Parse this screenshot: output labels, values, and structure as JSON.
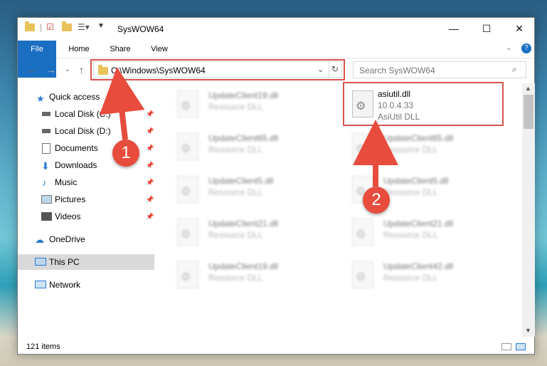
{
  "window": {
    "title": "SysWOW64"
  },
  "ribbon": {
    "tabs": [
      "File",
      "Home",
      "Share",
      "View"
    ]
  },
  "address": {
    "path": "C:\\Windows\\SysWOW64"
  },
  "search": {
    "placeholder": "Search SysWOW64"
  },
  "nav": {
    "items": [
      {
        "label": "Quick access",
        "icon": "star-icon",
        "pinned": false
      },
      {
        "label": "Local Disk (C:)",
        "icon": "drive-icon",
        "pinned": true
      },
      {
        "label": "Local Disk (D:)",
        "icon": "drive-icon",
        "pinned": true
      },
      {
        "label": "Documents",
        "icon": "documents-icon",
        "pinned": true
      },
      {
        "label": "Downloads",
        "icon": "downloads-icon",
        "pinned": true
      },
      {
        "label": "Music",
        "icon": "music-icon",
        "pinned": true
      },
      {
        "label": "Pictures",
        "icon": "pictures-icon",
        "pinned": true
      },
      {
        "label": "Videos",
        "icon": "videos-icon",
        "pinned": true
      },
      {
        "label": "OneDrive",
        "icon": "cloud-icon",
        "pinned": false
      },
      {
        "label": "This PC",
        "icon": "computer-icon",
        "pinned": false
      },
      {
        "label": "Network",
        "icon": "network-icon",
        "pinned": false
      }
    ]
  },
  "files": [
    {
      "name": "UpdateClient19.dll",
      "desc": "Resource DLL"
    },
    {
      "name": "asiutil.dll",
      "version": "10.0.4.33",
      "desc": "AsiUtil DLL"
    },
    {
      "name": "UpdateClient65.dll",
      "desc": "Resource DLL"
    },
    {
      "name": "UpdateClient65.dll",
      "desc": "Resource DLL"
    },
    {
      "name": "UpdateClient5.dll",
      "desc": "Resource DLL"
    },
    {
      "name": "UpdateClient5.dll",
      "desc": "Resource DLL"
    },
    {
      "name": "UpdateClient21.dll",
      "desc": "Resource DLL"
    },
    {
      "name": "UpdateClient21.dll",
      "desc": "Resource DLL"
    },
    {
      "name": "UpdateClient19.dll",
      "desc": "Resource DLL"
    },
    {
      "name": "UpdateClient42.dll",
      "desc": "Resource DLL"
    }
  ],
  "status": {
    "items": "121 items"
  },
  "callouts": [
    "1",
    "2"
  ],
  "colors": {
    "accent": "#1a6fc2",
    "highlight": "#d9534f",
    "callout": "#e74c3c"
  }
}
